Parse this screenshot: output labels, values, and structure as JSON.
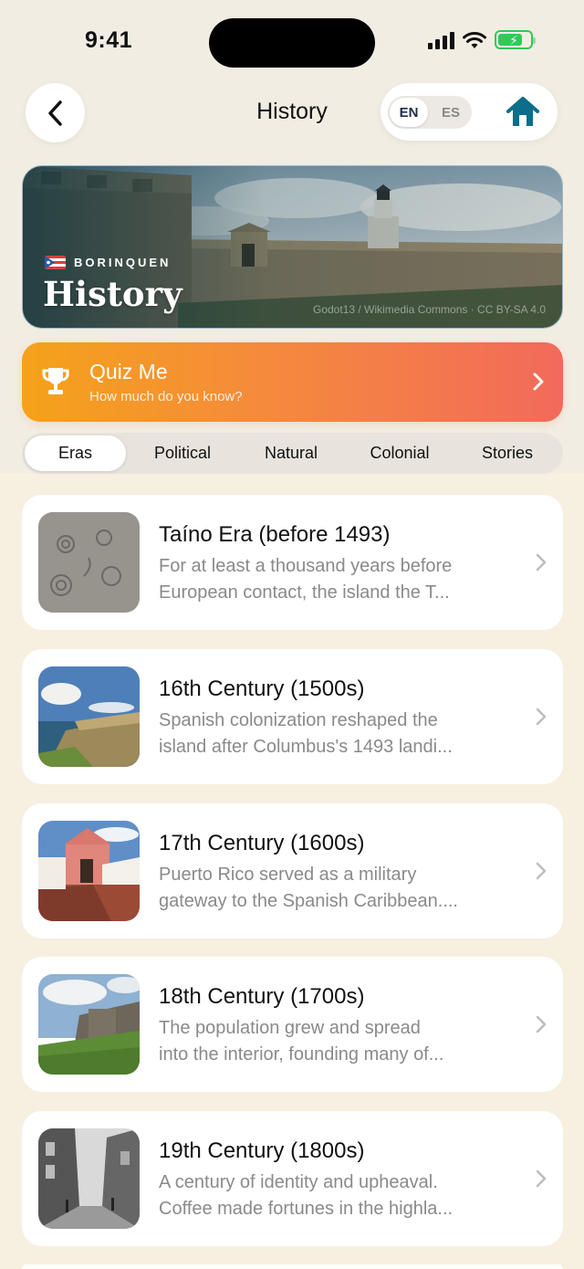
{
  "status": {
    "time": "9:41"
  },
  "header": {
    "title": "History",
    "lang_en": "EN",
    "lang_es": "ES",
    "active_lang": "EN"
  },
  "hero": {
    "subtitle": "BORINQUEN",
    "title": "History",
    "credit": "Godot13 / Wikimedia Commons · CC BY-SA 4.0"
  },
  "quiz": {
    "title": "Quiz Me",
    "subtitle": "How much do you know?"
  },
  "tabs": [
    {
      "label": "Eras",
      "active": true
    },
    {
      "label": "Political",
      "active": false
    },
    {
      "label": "Natural",
      "active": false
    },
    {
      "label": "Colonial",
      "active": false
    },
    {
      "label": "Stories",
      "active": false
    }
  ],
  "eras": [
    {
      "title": "Taíno Era (before 1493)",
      "line1": "For at least a thousand years before",
      "line2": "European contact, the island the T..."
    },
    {
      "title": "16th Century (1500s)",
      "line1": "Spanish colonization reshaped the",
      "line2": "island after Columbus's 1493 landi..."
    },
    {
      "title": "17th Century (1600s)",
      "line1": "Puerto Rico served as a military",
      "line2": "gateway to the Spanish Caribbean...."
    },
    {
      "title": "18th Century (1700s)",
      "line1": "The population grew and spread",
      "line2": "into the interior, founding many of..."
    },
    {
      "title": "19th Century (1800s)",
      "line1": "A century of identity and upheaval.",
      "line2": "Coffee made fortunes in the highla..."
    }
  ],
  "colors": {
    "accent": "#0b6e8a",
    "quiz_start": "#f5a21a",
    "quiz_end": "#f26a5b",
    "background": "#f7efe0"
  }
}
